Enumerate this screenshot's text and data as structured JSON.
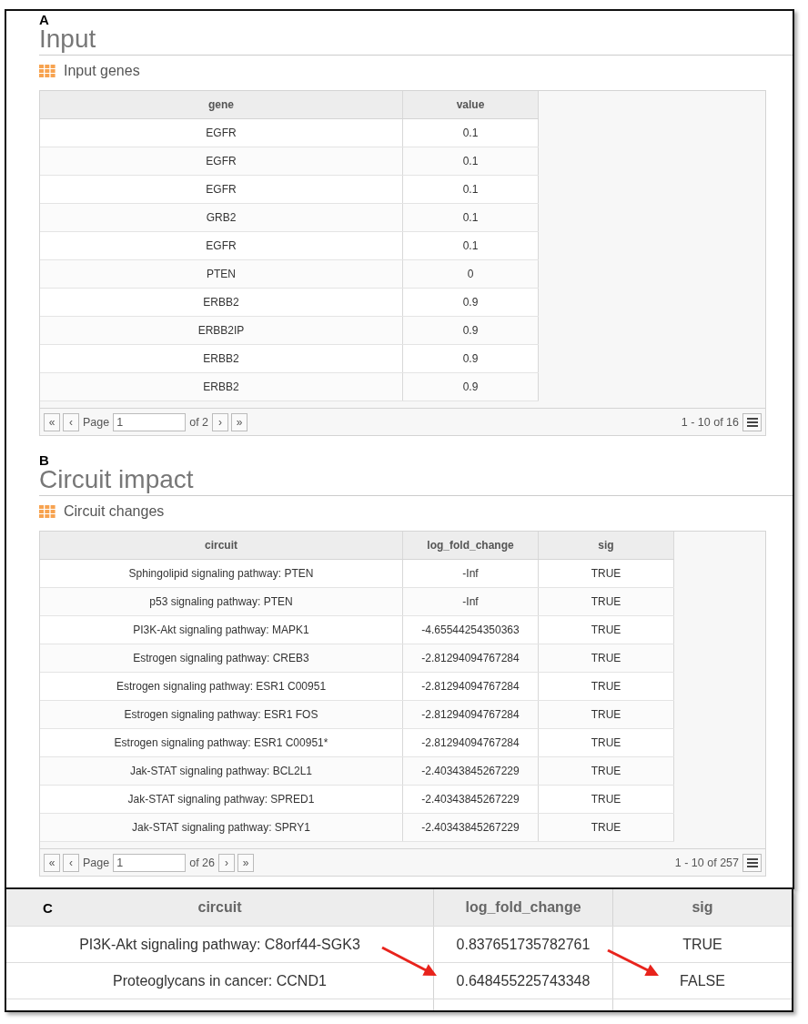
{
  "panels": [
    {
      "label": "A",
      "title": "Input",
      "section": "Input genes",
      "table": {
        "columns": [
          "gene",
          "value"
        ],
        "rows": [
          [
            "EGFR",
            "0.1"
          ],
          [
            "EGFR",
            "0.1"
          ],
          [
            "EGFR",
            "0.1"
          ],
          [
            "GRB2",
            "0.1"
          ],
          [
            "EGFR",
            "0.1"
          ],
          [
            "PTEN",
            "0"
          ],
          [
            "ERBB2",
            "0.9"
          ],
          [
            "ERBB2IP",
            "0.9"
          ],
          [
            "ERBB2",
            "0.9"
          ],
          [
            "ERBB2",
            "0.9"
          ]
        ]
      },
      "pager": {
        "first": "«",
        "prev": "‹",
        "page_label": "Page",
        "page": "1",
        "of": "of 2",
        "next": "›",
        "last": "»",
        "range": "1 - 10 of 16"
      }
    },
    {
      "label": "B",
      "title": "Circuit impact",
      "section": "Circuit changes",
      "table": {
        "columns": [
          "circuit",
          "log_fold_change",
          "sig"
        ],
        "rows": [
          [
            "Sphingolipid signaling pathway: PTEN",
            "-Inf",
            "TRUE"
          ],
          [
            "p53 signaling pathway: PTEN",
            "-Inf",
            "TRUE"
          ],
          [
            "PI3K-Akt signaling pathway: MAPK1",
            "-4.65544254350363",
            "TRUE"
          ],
          [
            "Estrogen signaling pathway: CREB3",
            "-2.81294094767284",
            "TRUE"
          ],
          [
            "Estrogen signaling pathway: ESR1 C00951",
            "-2.81294094767284",
            "TRUE"
          ],
          [
            "Estrogen signaling pathway: ESR1 FOS",
            "-2.81294094767284",
            "TRUE"
          ],
          [
            "Estrogen signaling pathway: ESR1 C00951*",
            "-2.81294094767284",
            "TRUE"
          ],
          [
            "Jak-STAT signaling pathway: BCL2L1",
            "-2.40343845267229",
            "TRUE"
          ],
          [
            "Jak-STAT signaling pathway: SPRED1",
            "-2.40343845267229",
            "TRUE"
          ],
          [
            "Jak-STAT signaling pathway: SPRY1",
            "-2.40343845267229",
            "TRUE"
          ]
        ]
      },
      "pager": {
        "first": "«",
        "prev": "‹",
        "page_label": "Page",
        "page": "1",
        "of": "of 26",
        "next": "›",
        "last": "»",
        "range": "1 - 10 of 257"
      }
    }
  ],
  "zoom_panel": {
    "label": "C",
    "columns": [
      "circuit",
      "log_fold_change",
      "sig"
    ],
    "rows": [
      [
        "PI3K-Akt signaling pathway: C8orf44-SGK3",
        "0.837651735782761",
        "TRUE"
      ],
      [
        "Proteoglycans in cancer: CCND1",
        "0.648455225743348",
        "FALSE"
      ]
    ]
  }
}
